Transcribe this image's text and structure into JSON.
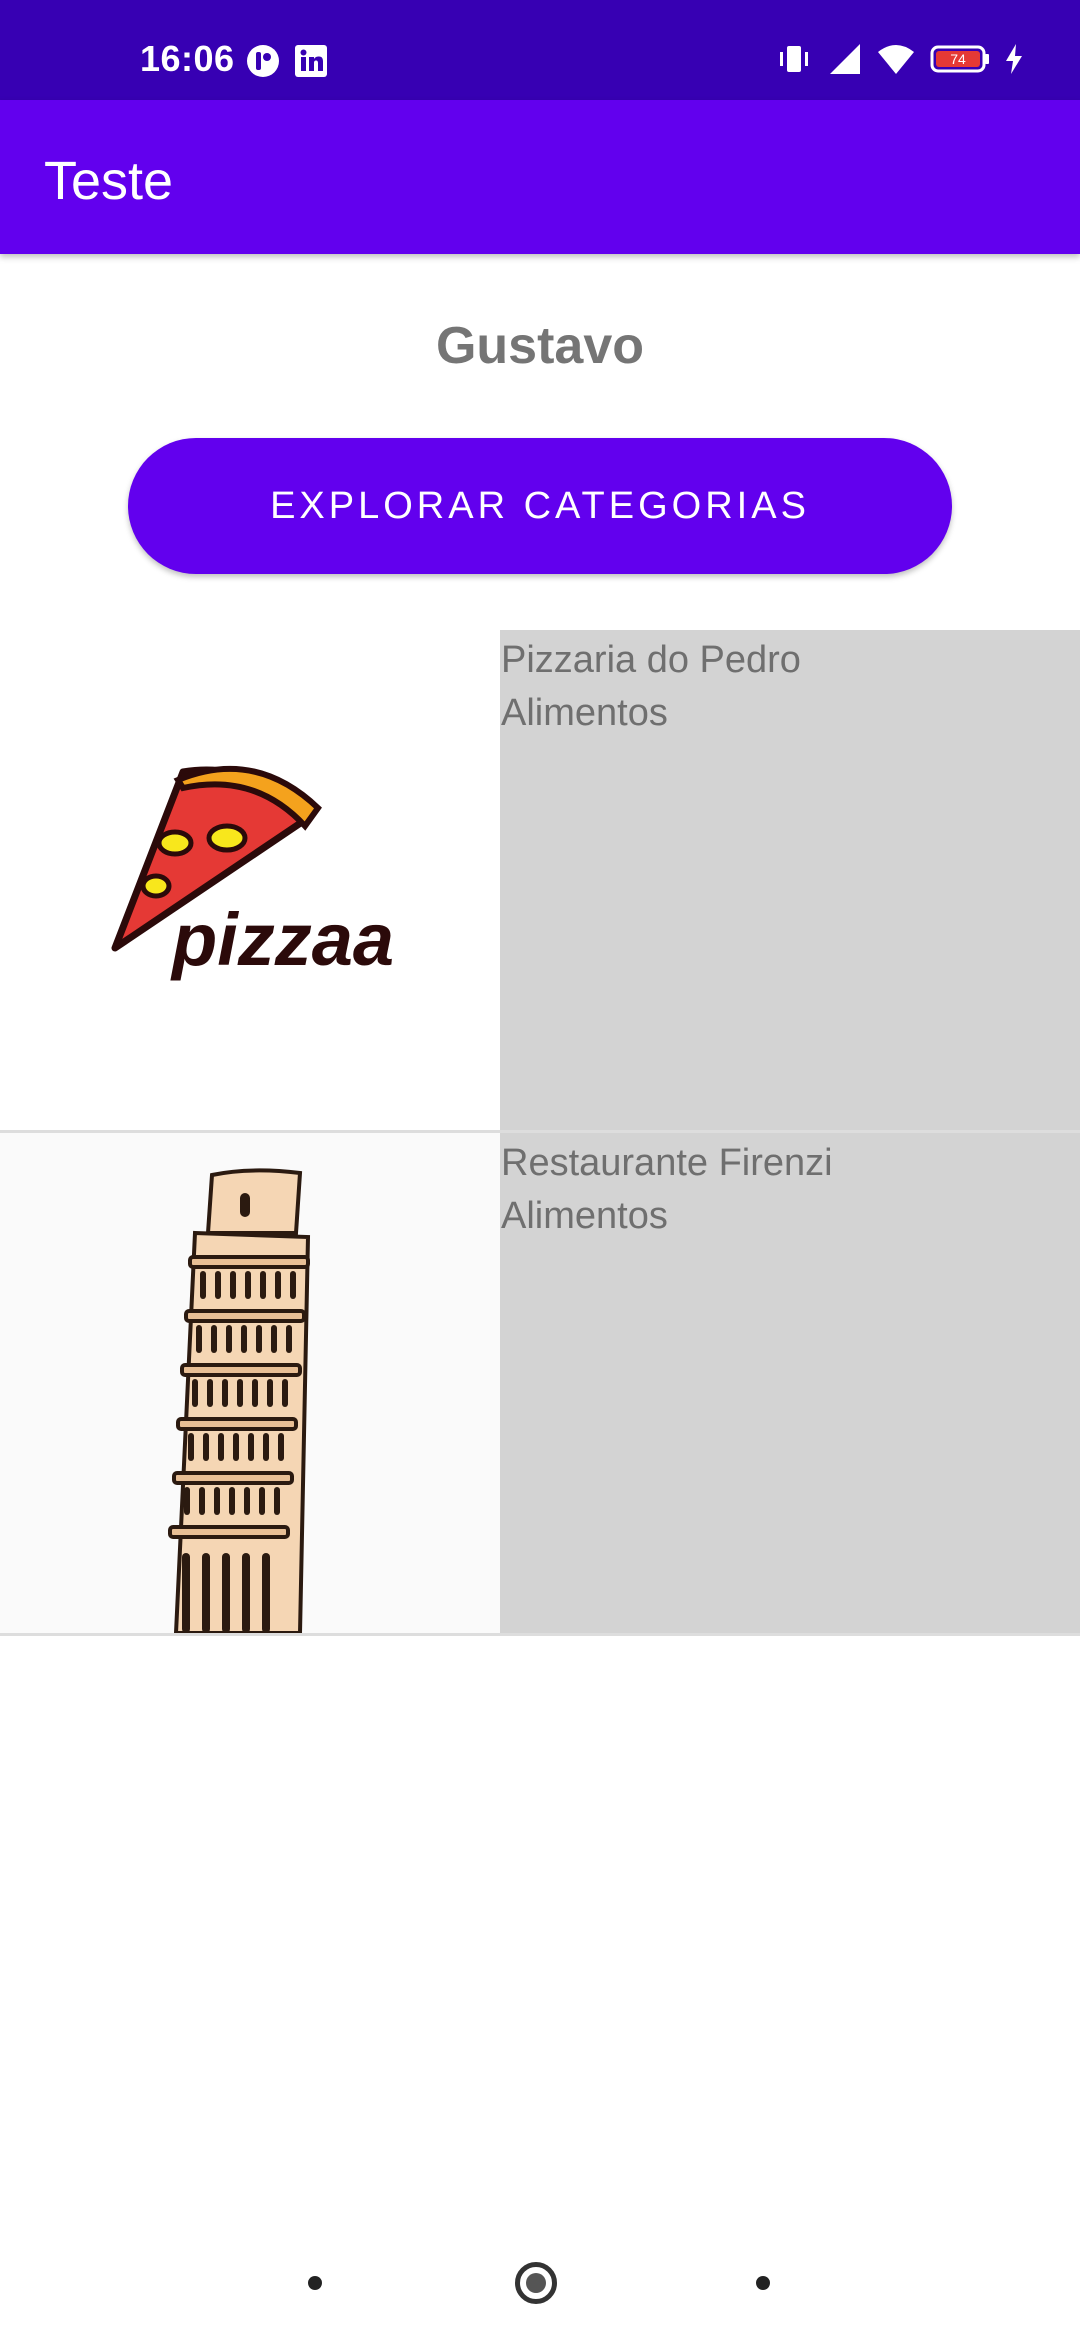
{
  "status_bar": {
    "time": "16:06",
    "left_icons": [
      "cultural-app-icon",
      "linkedin-icon"
    ],
    "right_icons": [
      "vibrate-icon",
      "signal-icon",
      "wifi-icon",
      "battery-icon",
      "charging-icon"
    ],
    "battery_level": "74"
  },
  "app_bar": {
    "title": "Teste"
  },
  "user": {
    "name": "Gustavo"
  },
  "explore_button": {
    "label": "EXPLORAR CATEGORIAS"
  },
  "stores": [
    {
      "name": "Pizzaria do Pedro",
      "category": "Alimentos",
      "image": "pizza-logo"
    },
    {
      "name": "Restaurante Firenzi",
      "category": "Alimentos",
      "image": "leaning-tower-of-pisa"
    }
  ],
  "pizza_logo_text": "pizzaa",
  "nav_bar": {
    "buttons": [
      "back-button",
      "home-button",
      "recents-button"
    ]
  },
  "colors": {
    "status_bar": "#3700b3",
    "primary": "#6200ee",
    "list_info_background": "#d3d3d3",
    "battery_low": "#e53935"
  }
}
